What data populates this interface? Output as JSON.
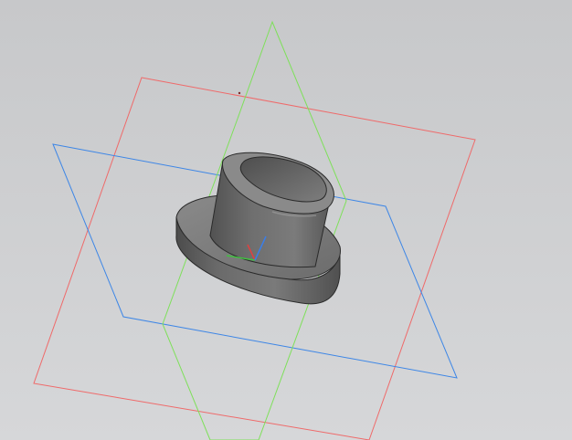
{
  "viewport": {
    "background_top": "#c7c8ca",
    "background_bottom": "#d6d7d9"
  },
  "model": {
    "type": "flanged-bushing",
    "body_color": "#6e6e6e",
    "edge_color": "#2a2a2a"
  },
  "planes": [
    {
      "name": "plane-xy",
      "color": "#ef6a6a"
    },
    {
      "name": "plane-zx",
      "color": "#3d86e6"
    },
    {
      "name": "plane-yz",
      "color": "#7ee05a"
    }
  ],
  "axis_triad": {
    "x_color": "#e04040",
    "y_color": "#40c040",
    "z_color": "#3a7ee8"
  }
}
